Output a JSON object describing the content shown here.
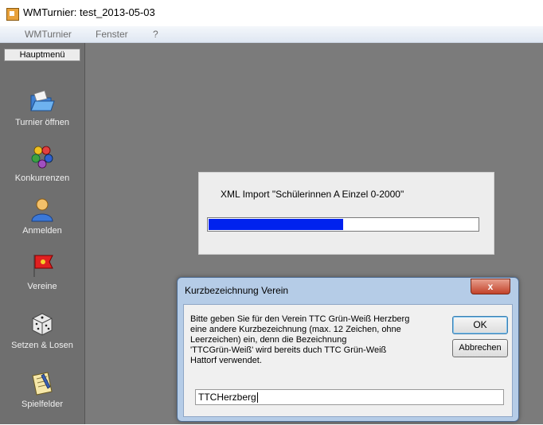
{
  "window": {
    "title": "WMTurnier: test_2013-05-03"
  },
  "menu": {
    "items": [
      "WMTurnier",
      "Fenster",
      "?"
    ]
  },
  "sidebar": {
    "header": "Hauptmenü",
    "items": [
      {
        "label": "Turnier öffnen",
        "icon": "folder-open-icon"
      },
      {
        "label": "Konkurrenzen",
        "icon": "group-icon"
      },
      {
        "label": "Anmelden",
        "icon": "person-icon"
      },
      {
        "label": "Vereine",
        "icon": "flag-icon"
      },
      {
        "label": "Setzen & Losen",
        "icon": "dice-icon"
      },
      {
        "label": "Spielfelder",
        "icon": "clipboard-icon"
      }
    ]
  },
  "progress": {
    "text": "XML Import \"Schülerinnen A Einzel 0-2000\"",
    "fraction": 0.5,
    "color": "#0022ee"
  },
  "dialog": {
    "title": "Kurzbezeichnung Verein",
    "close_label": "x",
    "message_lines": [
      "Bitte geben Sie für den Verein TTC Grün-Weiß Herzberg",
      "eine andere Kurzbezeichnung (max. 12 Zeichen, ohne",
      "Leerzeichen) ein, denn die Bezeichnung",
      "'TTCGrün-Weiß' wird bereits duch TTC Grün-Weiß",
      "Hattorf verwendet."
    ],
    "ok_label": "OK",
    "cancel_label": "Abbrechen",
    "input_value": "TTCHerzberg"
  }
}
